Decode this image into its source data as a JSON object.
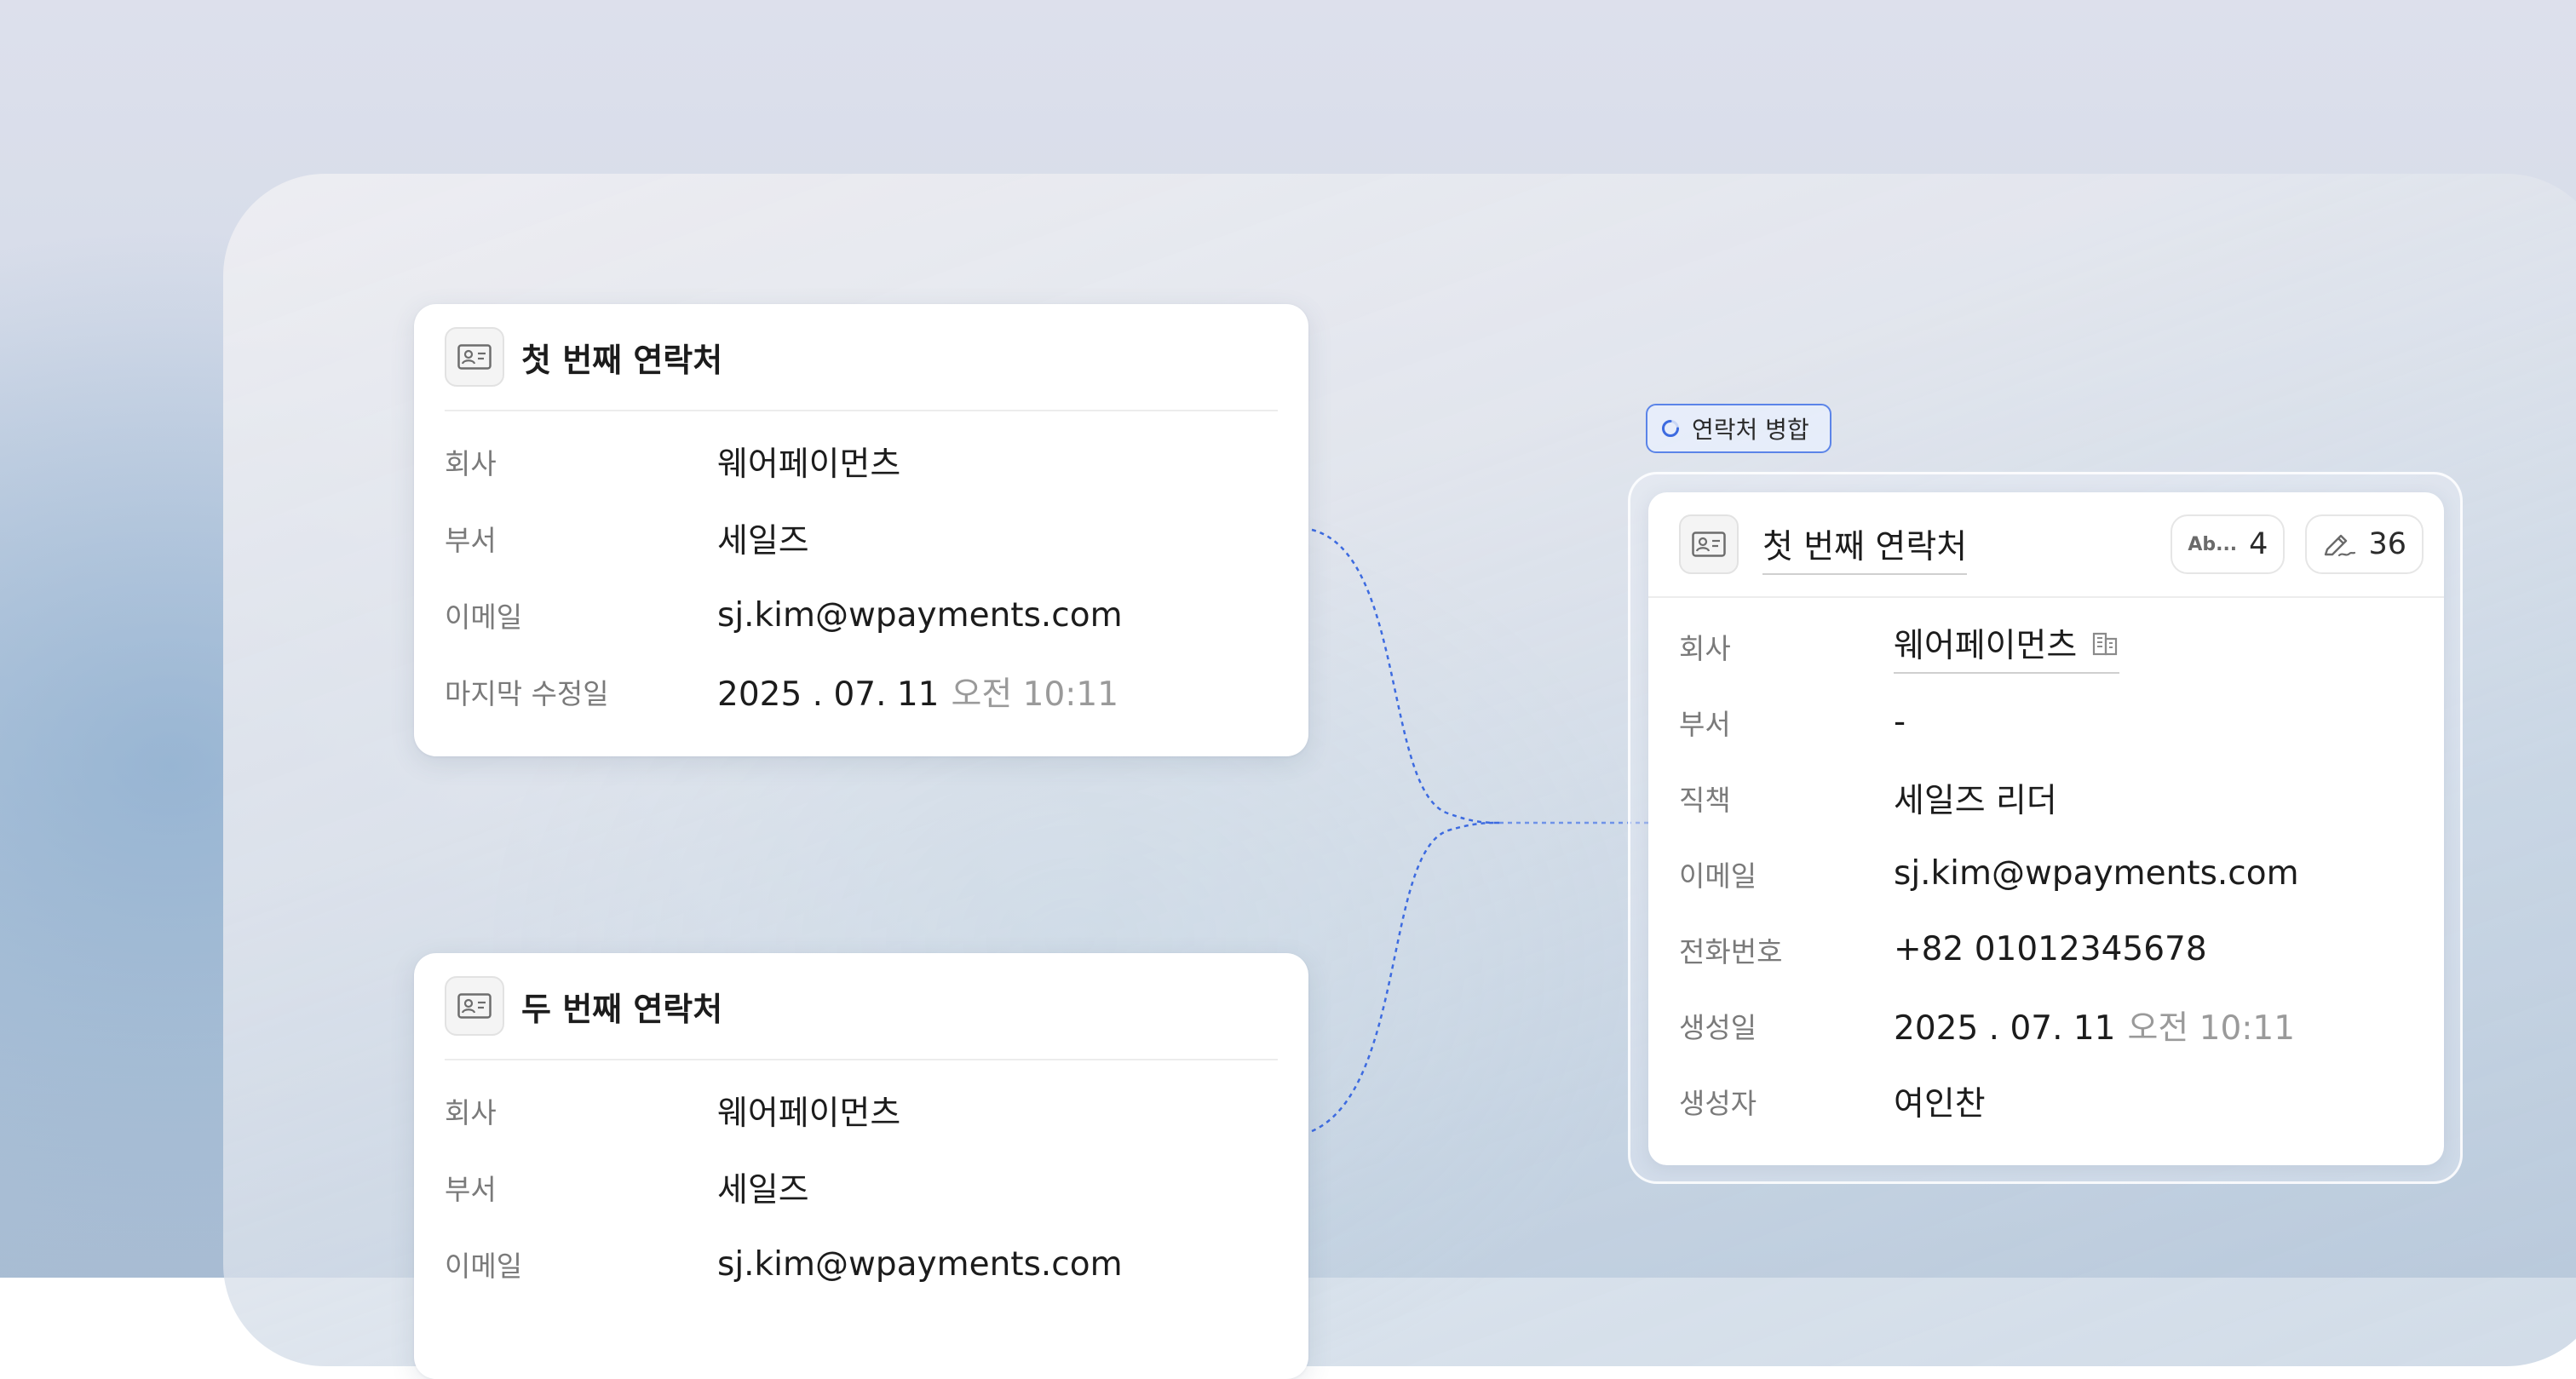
{
  "first_contact": {
    "title": "첫 번째 연락처",
    "icon": "contact-card-icon",
    "fields": [
      {
        "label": "회사",
        "value": "웨어페이먼츠"
      },
      {
        "label": "부서",
        "value": "세일즈"
      },
      {
        "label": "이메일",
        "value": "sj.kim@wpayments.com"
      },
      {
        "label": "마지막 수정일",
        "value": "2025 . 07. 11",
        "time": "오전 10:11"
      }
    ]
  },
  "second_contact": {
    "title": "두 번째 연락처",
    "icon": "contact-card-icon",
    "fields": [
      {
        "label": "회사",
        "value": "웨어페이먼츠"
      },
      {
        "label": "부서",
        "value": "세일즈"
      },
      {
        "label": "이메일",
        "value": "sj.kim@wpayments.com"
      }
    ]
  },
  "merge": {
    "label": "연락처 병합",
    "icon": "spinner-icon",
    "accent_color": "#5b84e8"
  },
  "merged_contact": {
    "title": "첫 번째 연락처",
    "icon": "contact-card-icon",
    "badges": {
      "text_fields": {
        "icon": "text-field-icon",
        "icon_text": "Ab...",
        "count": "4"
      },
      "edits": {
        "icon": "signature-pen-icon",
        "count": "36"
      }
    },
    "fields": [
      {
        "label": "회사",
        "value": "웨어페이먼츠",
        "icon": "building-icon"
      },
      {
        "label": "부서",
        "value": "-"
      },
      {
        "label": "직책",
        "value": "세일즈 리더"
      },
      {
        "label": "이메일",
        "value": "sj.kim@wpayments.com"
      },
      {
        "label": "전화번호",
        "value": "+82 01012345678"
      },
      {
        "label": "생성일",
        "value": "2025 . 07. 11",
        "time": "오전 10:11"
      },
      {
        "label": "생성자",
        "value": "여인찬"
      }
    ]
  }
}
